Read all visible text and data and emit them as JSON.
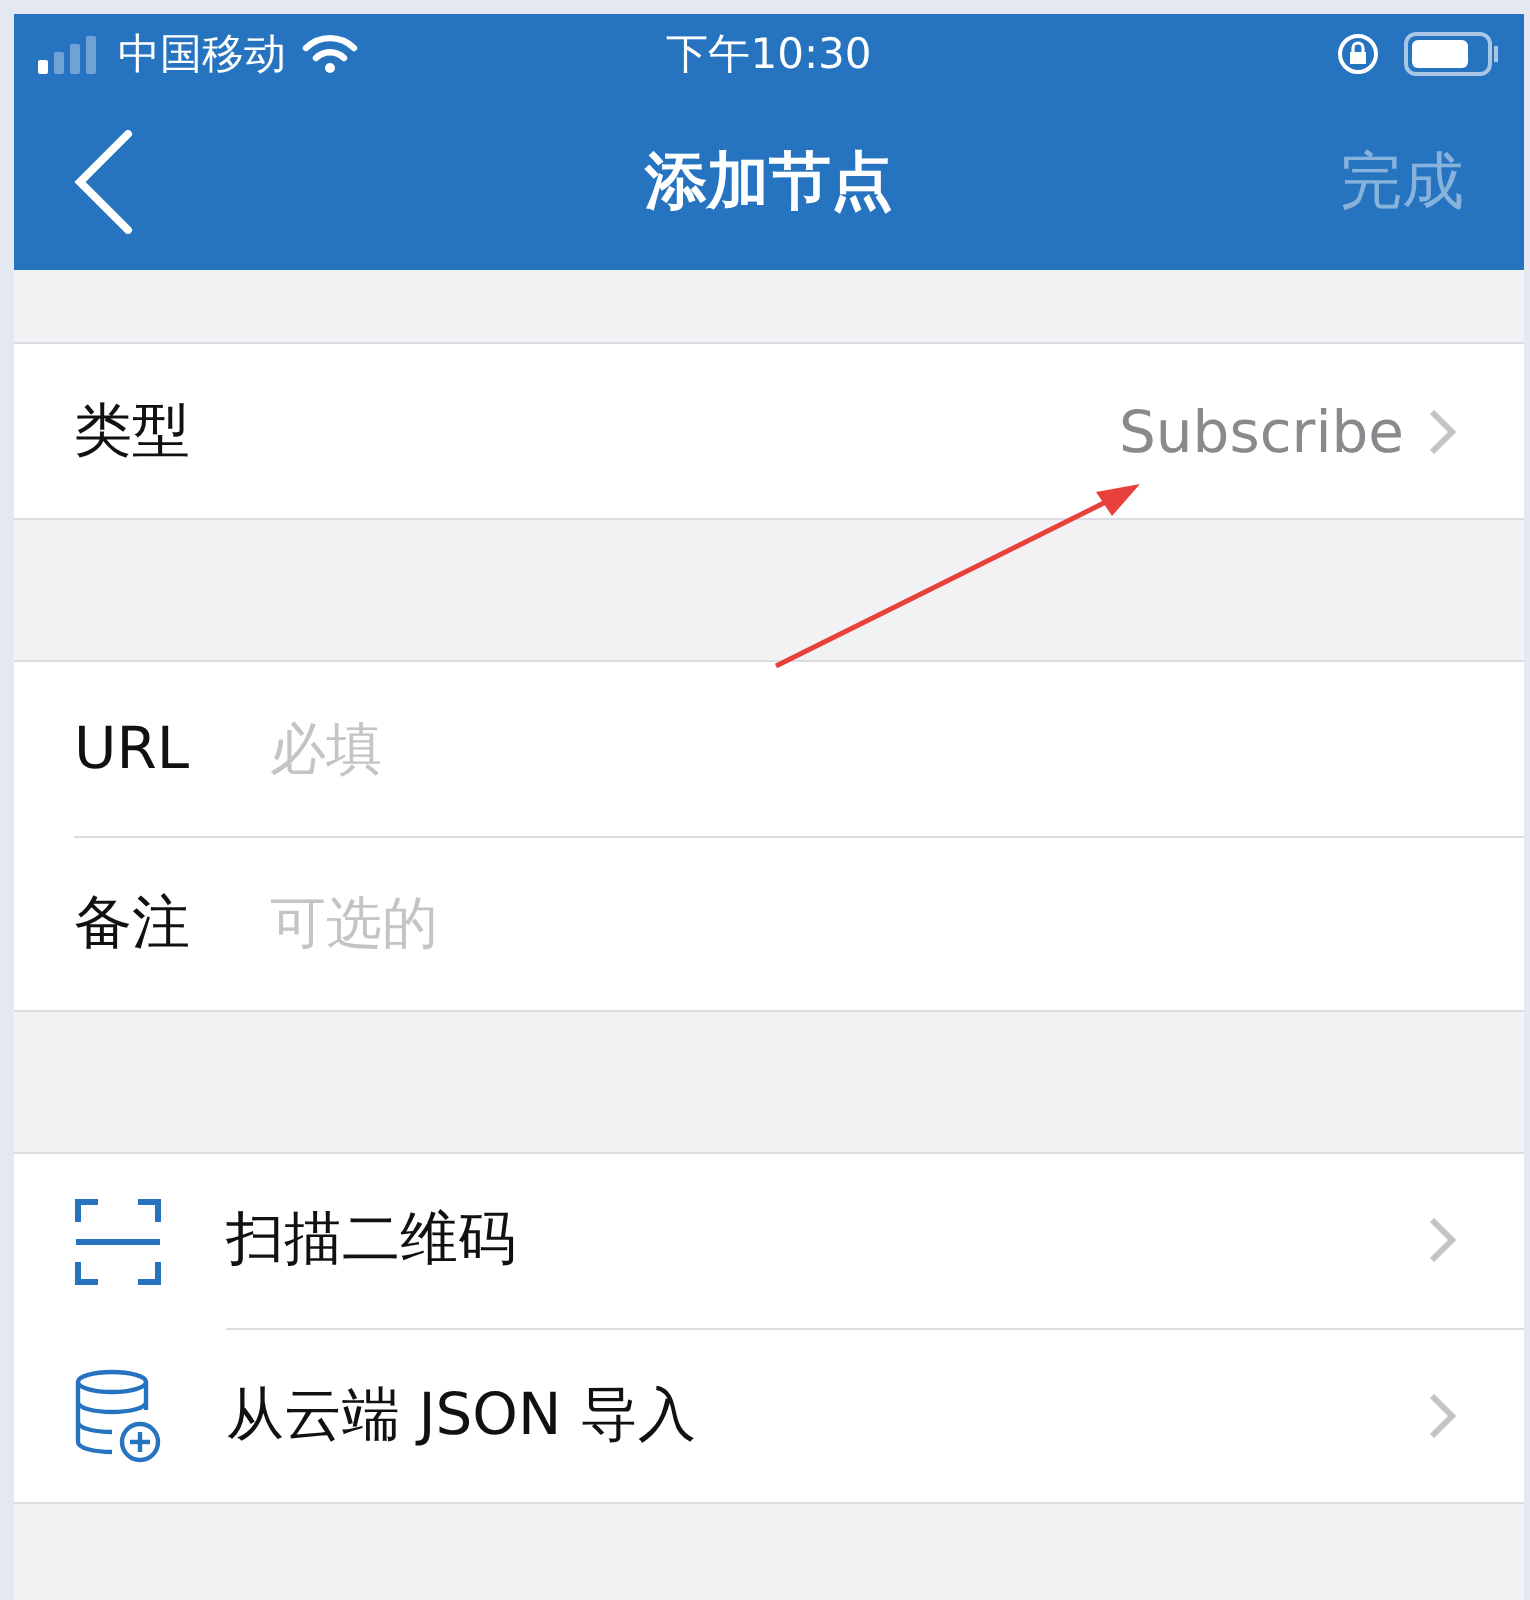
{
  "status_bar": {
    "carrier": "中国移动",
    "time": "下午10:30"
  },
  "nav": {
    "title": "添加节点",
    "done": {
      "label": "完成",
      "disabled": true
    }
  },
  "type_row": {
    "label": "类型",
    "value": "Subscribe"
  },
  "fields": [
    {
      "label": "URL",
      "placeholder": "必填"
    },
    {
      "label": "备注",
      "placeholder": "可选的"
    }
  ],
  "actions": [
    {
      "kind": "scan",
      "label": "扫描二维码"
    },
    {
      "kind": "import",
      "label": "从云端 JSON 导入"
    }
  ]
}
